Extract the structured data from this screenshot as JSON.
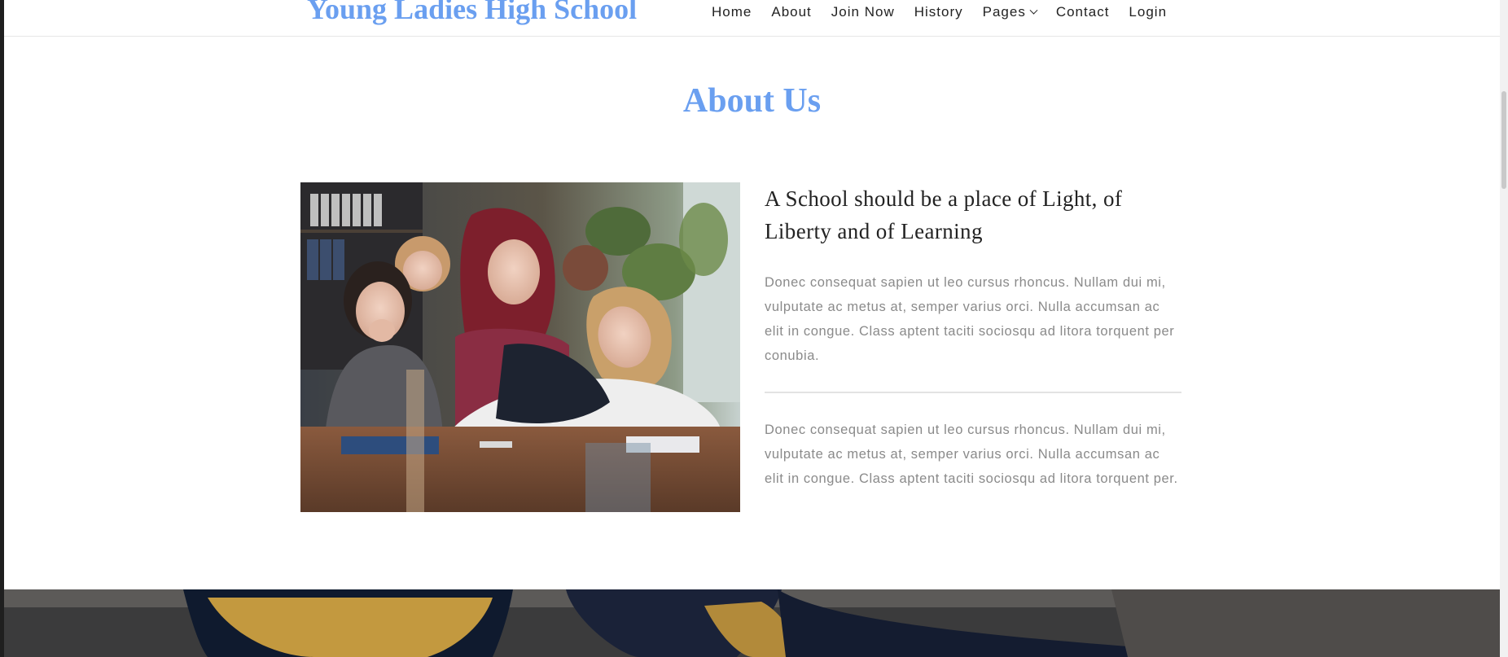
{
  "header": {
    "brand": "Young Ladies High School",
    "nav": [
      {
        "label": "Home"
      },
      {
        "label": "About"
      },
      {
        "label": "Join Now"
      },
      {
        "label": "History"
      },
      {
        "label": "Pages",
        "icon": "chevron-down-icon"
      },
      {
        "label": "Contact"
      },
      {
        "label": "Login"
      }
    ]
  },
  "about": {
    "title": "About Us",
    "heading": "A School should be a place of Light, of Liberty and of Learning",
    "paragraphs": [
      "Donec consequat sapien ut leo cursus rhoncus. Nullam dui mi, vulputate ac metus at, semper varius orci. Nulla accumsan ac elit in congue. Class aptent taciti sociosqu ad litora torquent per conubia.",
      "Donec consequat sapien ut leo cursus rhoncus. Nullam dui mi, vulputate ac metus at, semper varius orci. Nulla accumsan ac elit in congue. Class aptent taciti sociosqu ad litora torquent per."
    ]
  },
  "colors": {
    "accent": "#6a9ff0",
    "heading": "#222222",
    "body_text": "#8a8a8a",
    "divider": "#e3e3e3"
  }
}
